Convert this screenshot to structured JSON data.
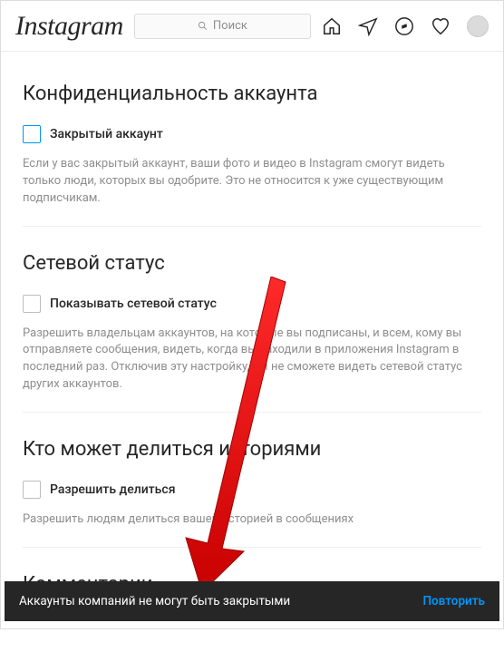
{
  "header": {
    "logo": "Instagram",
    "search_placeholder": "Поиск"
  },
  "sections": {
    "privacy": {
      "title": "Конфиденциальность аккаунта",
      "checkbox_label": "Закрытый аккаунт",
      "description": "Если у вас закрытый аккаунт, ваши фото и видео в Instagram смогут видеть только люди, которых вы одобрите. Это не относится к уже существующим подписчикам."
    },
    "activity": {
      "title": "Сетевой статус",
      "checkbox_label": "Показывать сетевой статус",
      "description": "Разрешить владельцам аккаунтов, на которые вы подписаны, и всем, кому вы отправляете сообщения, видеть, когда вы заходили в приложения Instagram в последний раз. Отключив эту настройку, вы не сможете видеть сетевой статус других аккаунтов."
    },
    "story": {
      "title": "Кто может делиться историями",
      "checkbox_label": "Разрешить делиться",
      "description": "Разрешить людям делиться вашей историей в сообщениях"
    },
    "comments": {
      "title": "Комментарии"
    }
  },
  "toast": {
    "message": "Аккаунты компаний не могут быть закрытыми",
    "retry": "Повторить"
  }
}
